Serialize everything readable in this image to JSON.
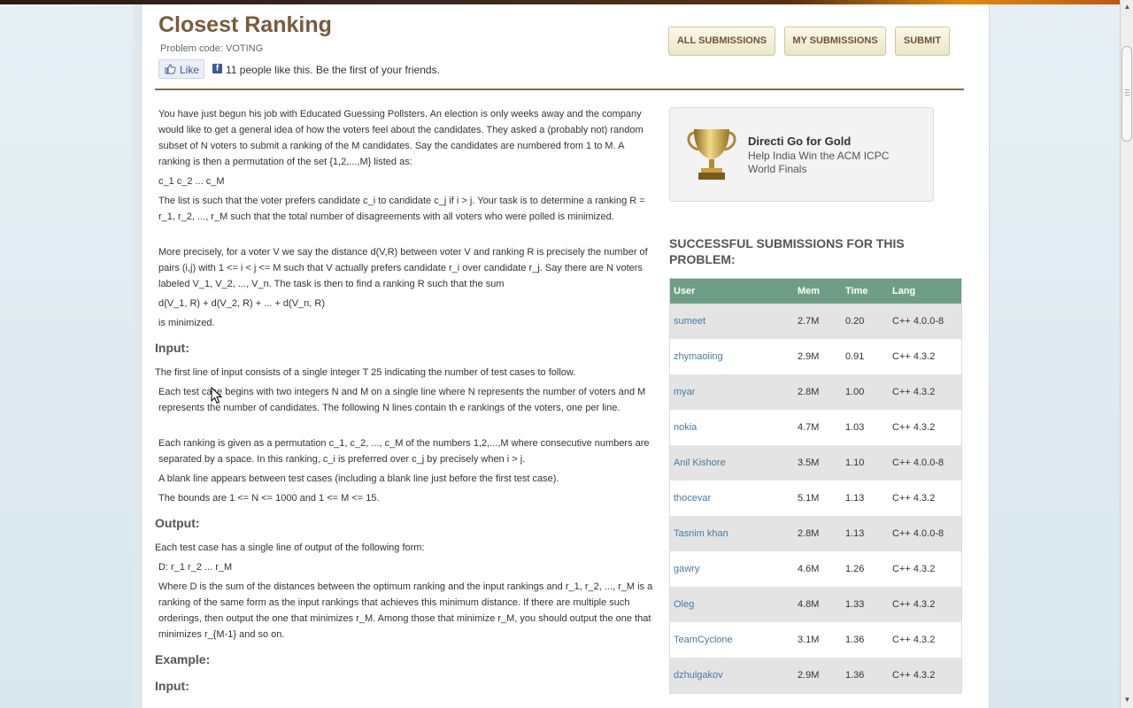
{
  "problem": {
    "title": "Closest Ranking",
    "code_label": "Problem code: VOTING"
  },
  "social": {
    "like_label": "Like",
    "like_text": "11 people like this. Be the first of your friends."
  },
  "actions": {
    "all_submissions": "ALL SUBMISSIONS",
    "my_submissions": "MY SUBMISSIONS",
    "submit": "SUBMIT"
  },
  "statement": {
    "p1": "You have just begun his job with Educated Guessing Pollsters. An election is only weeks away and the company would like to get a general idea of how the voters feel about the candidates. They asked a (probably not) random subset of N voters to submit a ranking of the M candidates. Say the candidates are numbered from 1 to M. A ranking is then a permutation of the set {1,2,...,M} listed as:",
    "p2": "c_1 c_2 ... c_M",
    "p3": "The list is such that the voter prefers candidate c_i to candidate c_j if i > j. Your task is to determine a ranking R = r_1, r_2, ..., r_M such that the total number of disagreements with all voters who were polled is minimized.",
    "p4": "More precisely, for a voter V we say the distance d(V,R) between voter V and ranking R is precisely the number of pairs (i,j) with 1 <= i < j <= M such that V actually prefers candidate r_i over candidate r_j. Say there are N voters labeled V_1, V_2, ..., V_n. The task is then to find a ranking R such that the sum",
    "p5": "d(V_1, R) + d(V_2, R) + ... + d(V_n, R)",
    "p6": "is minimized.",
    "input_heading": "Input:",
    "in1": "The first line of input consists of a single integer T 25 indicating the number of test cases to follow.",
    "in2": "Each test case begins with two integers N and M on a single line where N represents the number of voters and M represents the number of candidates. The following N lines contain th e rankings of the voters, one per line.",
    "in3": "Each ranking is given as a permutation c_1, c_2, ..., c_M of the numbers 1,2,...,M where consecutive numbers are separated by a space. In this ranking, c_i is preferred over c_j by precisely when i > j.",
    "in4": "A blank line appears between test cases (including a blank line just before the first test case).",
    "in5": "The bounds are 1 <= N <= 1000 and 1 <= M <= 15.",
    "output_heading": "Output:",
    "out1": "Each test case has a single line of output of the following form:",
    "out2": "D: r_1 r_2 ... r_M",
    "out3": "Where D is the sum of the distances between the optimum ranking and the input rankings and r_1, r_2, ..., r_M is a ranking of the same form as the input rankings that achieves this minimum distance. If there are multiple such orderings, then output the one that minimizes r_M. Among those that minimize r_M, you should output the one that minimizes r_{M-1} and so on.",
    "example_heading": "Example:",
    "example_input_heading": "Input:"
  },
  "promo": {
    "title": "Directi Go for Gold",
    "subtitle": "Help India Win the ACM ICPC World Finals",
    "icon": "trophy-icon"
  },
  "submissions": {
    "heading": "SUCCESSFUL SUBMISSIONS FOR THIS PROBLEM:",
    "columns": [
      "User",
      "Mem",
      "Time",
      "Lang"
    ],
    "rows": [
      {
        "user": "sumeet",
        "mem": "2.7M",
        "time": "0.20",
        "lang": "C++ 4.0.0-8"
      },
      {
        "user": "zhymaoiing",
        "mem": "2.9M",
        "time": "0.91",
        "lang": "C++ 4.3.2"
      },
      {
        "user": "myar",
        "mem": "2.8M",
        "time": "1.00",
        "lang": "C++ 4.3.2"
      },
      {
        "user": "nokia",
        "mem": "4.7M",
        "time": "1.03",
        "lang": "C++ 4.3.2"
      },
      {
        "user": "Anil Kishore",
        "mem": "3.5M",
        "time": "1.10",
        "lang": "C++ 4.0.0-8"
      },
      {
        "user": "thocevar",
        "mem": "5.1M",
        "time": "1.13",
        "lang": "C++ 4.3.2"
      },
      {
        "user": "Tasnim khan",
        "mem": "2.8M",
        "time": "1.13",
        "lang": "C++ 4.0.0-8"
      },
      {
        "user": "gawry",
        "mem": "4.6M",
        "time": "1.26",
        "lang": "C++ 4.3.2"
      },
      {
        "user": "Oleg",
        "mem": "4.8M",
        "time": "1.33",
        "lang": "C++ 4.3.2"
      },
      {
        "user": "TeamCyclone",
        "mem": "3.1M",
        "time": "1.36",
        "lang": "C++ 4.3.2"
      },
      {
        "user": "dzhulgakov",
        "mem": "2.9M",
        "time": "1.36",
        "lang": "C++ 4.3.2"
      }
    ]
  },
  "colors": {
    "title": "#7a5a3a",
    "table_header": "#6e9e86",
    "link": "#4a7aa0",
    "button_text": "#6d5538"
  }
}
